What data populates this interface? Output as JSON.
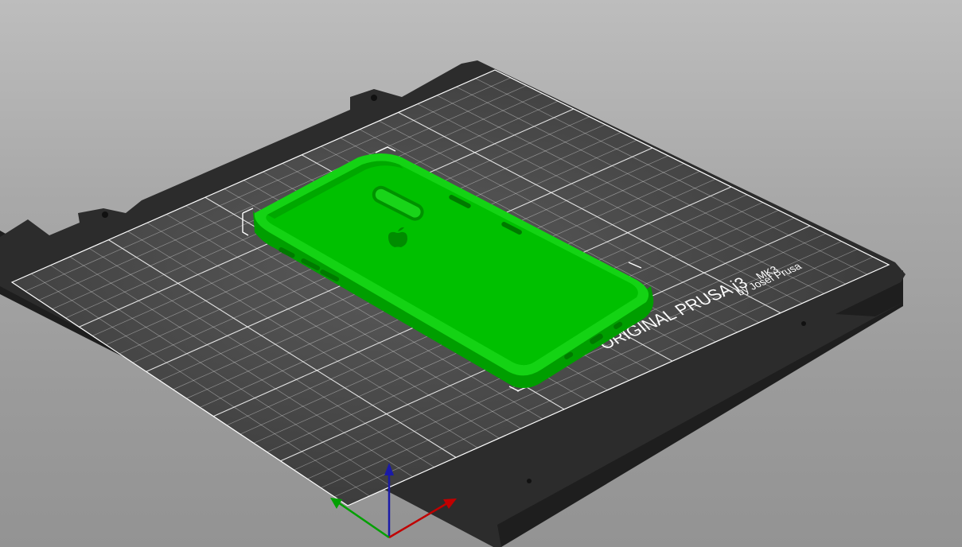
{
  "bed": {
    "brand": "ORIGINAL PRUSA i3",
    "model": "MK3",
    "byline": "by Josef Prusa",
    "grid_count": 25
  },
  "colors": {
    "bed_plate": "#2a2a2a",
    "bed_top": "#404040",
    "grid_line": "#ffffff",
    "model_fill": "#00c400",
    "model_dark": "#009a00",
    "model_light": "#19d819",
    "axis_x": "#c00000",
    "axis_y": "#00a000",
    "axis_z": "#1a1aa8"
  },
  "axes": {
    "x_icon": "axis-x-arrow-icon",
    "y_icon": "axis-y-arrow-icon",
    "z_icon": "axis-z-arrow-icon"
  },
  "object": {
    "name": "phone-case",
    "logo_icon": "apple-logo-icon"
  }
}
